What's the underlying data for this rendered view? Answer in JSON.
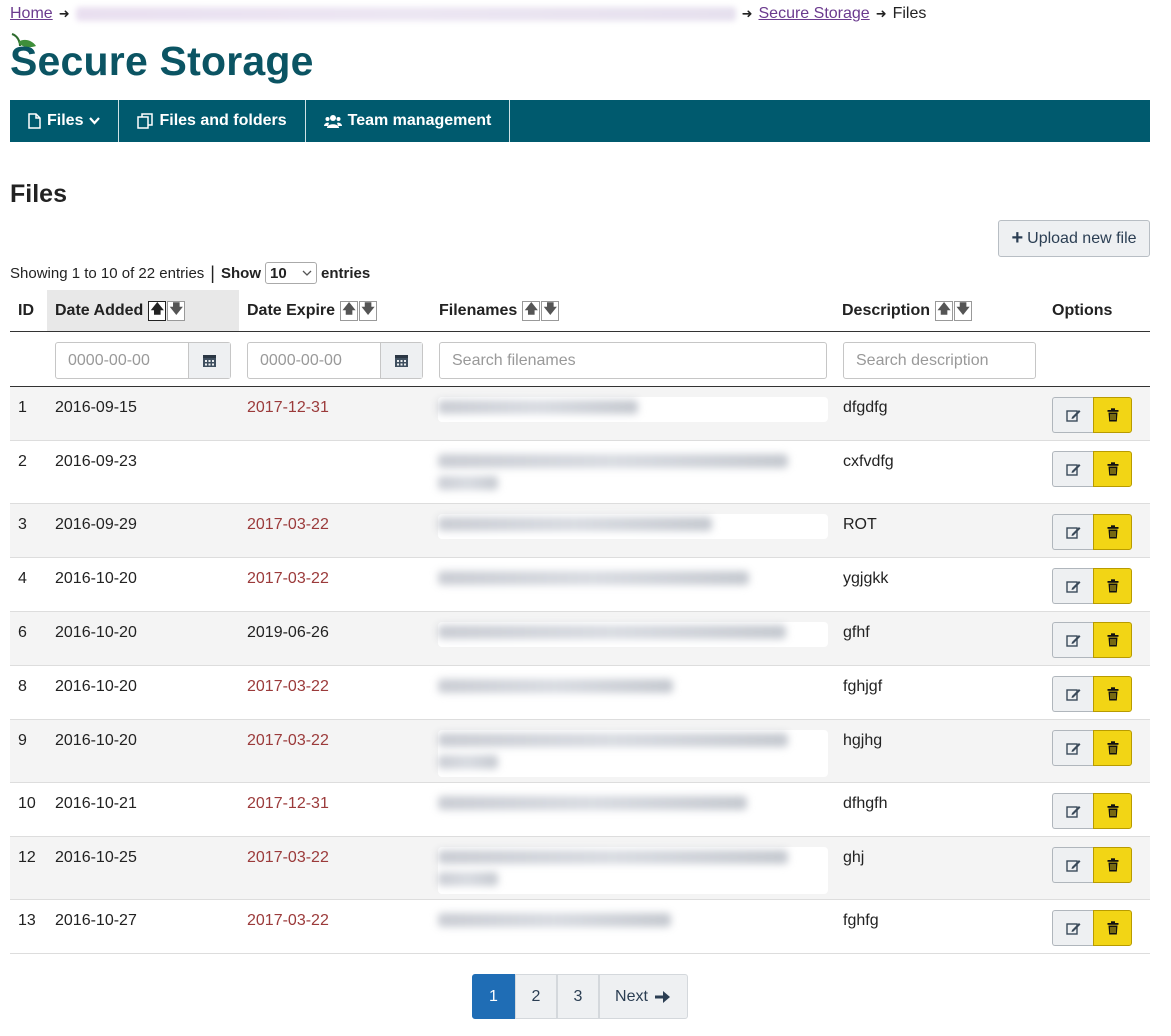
{
  "breadcrumb": {
    "home": "Home",
    "secure_storage": "Secure Storage",
    "current": "Files"
  },
  "site": {
    "title": "Secure Storage"
  },
  "nav": {
    "files": "Files",
    "files_and_folders": "Files and folders",
    "team_management": "Team management"
  },
  "page": {
    "title": "Files"
  },
  "toolbar": {
    "upload_label": "Upload new file"
  },
  "listing": {
    "showing": "Showing 1 to 10 of 22 entries",
    "show_label": "Show",
    "page_size": "10",
    "entries_label": "entries"
  },
  "table": {
    "headers": {
      "id": "ID",
      "date_added": "Date Added",
      "date_expire": "Date Expire",
      "filenames": "Filenames",
      "description": "Description",
      "options": "Options"
    },
    "filters": {
      "date_added_placeholder": "0000-00-00",
      "date_expire_placeholder": "0000-00-00",
      "filenames_placeholder": "Search filenames",
      "description_placeholder": "Search description"
    },
    "rows": [
      {
        "id": "1",
        "added": "2016-09-15",
        "expire": "2017-12-31",
        "expired": true,
        "description": "dfgdfg",
        "lines": 1
      },
      {
        "id": "2",
        "added": "2016-09-23",
        "expire": "",
        "expired": false,
        "description": "cxfvdfg",
        "lines": 2
      },
      {
        "id": "3",
        "added": "2016-09-29",
        "expire": "2017-03-22",
        "expired": true,
        "description": "ROT",
        "lines": 1
      },
      {
        "id": "4",
        "added": "2016-10-20",
        "expire": "2017-03-22",
        "expired": true,
        "description": "ygjgkk",
        "lines": 1
      },
      {
        "id": "6",
        "added": "2016-10-20",
        "expire": "2019-06-26",
        "expired": false,
        "description": "gfhf",
        "lines": 1
      },
      {
        "id": "8",
        "added": "2016-10-20",
        "expire": "2017-03-22",
        "expired": true,
        "description": "fghjgf",
        "lines": 1
      },
      {
        "id": "9",
        "added": "2016-10-20",
        "expire": "2017-03-22",
        "expired": true,
        "description": "hgjhg",
        "lines": 2
      },
      {
        "id": "10",
        "added": "2016-10-21",
        "expire": "2017-12-31",
        "expired": true,
        "description": "dfhgfh",
        "lines": 1
      },
      {
        "id": "12",
        "added": "2016-10-25",
        "expire": "2017-03-22",
        "expired": true,
        "description": "ghj",
        "lines": 2
      },
      {
        "id": "13",
        "added": "2016-10-27",
        "expire": "2017-03-22",
        "expired": true,
        "description": "fghfg",
        "lines": 1
      }
    ]
  },
  "pagination": {
    "pages": [
      "1",
      "2",
      "3"
    ],
    "current": "1",
    "next": "Next"
  },
  "colors": {
    "brand": "#0b5463",
    "navbar": "#005a6e",
    "expired_date": "#9b3a3a",
    "delete_button": "#f2d515",
    "active_page": "#1f6db5"
  }
}
